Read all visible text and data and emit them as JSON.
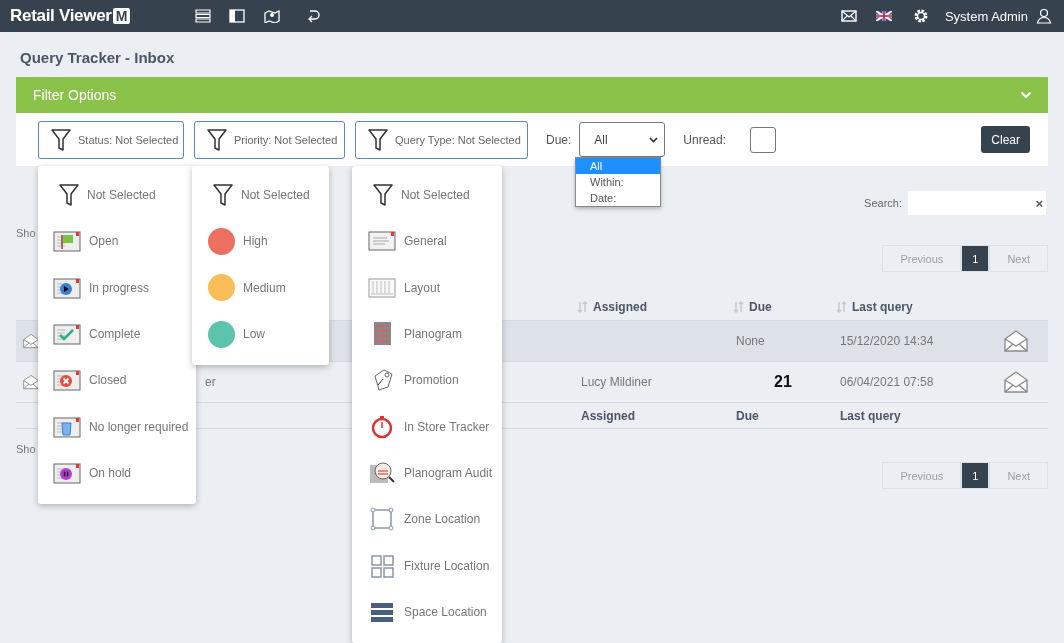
{
  "top_bar": {
    "logo": "Retail Viewer",
    "logo_badge": "M",
    "user": "System Admin"
  },
  "page_title": "Query Tracker - Inbox",
  "filter_panel": {
    "title": "Filter Options",
    "filters": [
      {
        "label": "Status: Not Selected"
      },
      {
        "label": "Priority: Not Selected"
      },
      {
        "label": "Query Type: Not Selected"
      }
    ],
    "due": {
      "label": "Due:",
      "value": "All",
      "options": [
        {
          "label": "All",
          "selected": true
        },
        {
          "label": "Within:",
          "selected": false
        },
        {
          "label": "Date:",
          "selected": false
        }
      ]
    },
    "unread": {
      "label": "Unread:",
      "checked": false
    },
    "clear": "Clear"
  },
  "status_menu": [
    {
      "label": "Not Selected",
      "kind": "none"
    },
    {
      "label": "Open",
      "kind": "icon"
    },
    {
      "label": "In progress",
      "kind": "icon"
    },
    {
      "label": "Complete",
      "kind": "icon"
    },
    {
      "label": "Closed",
      "kind": "icon"
    },
    {
      "label": "No longer required",
      "kind": "icon"
    },
    {
      "label": "On hold",
      "kind": "icon"
    }
  ],
  "priority_menu": [
    {
      "label": "Not Selected",
      "kind": "none"
    },
    {
      "label": "High",
      "kind": "dot",
      "color": "#ec6f5f"
    },
    {
      "label": "Medium",
      "kind": "dot",
      "color": "#f9be55"
    },
    {
      "label": "Low",
      "kind": "dot",
      "color": "#5cc3ad"
    }
  ],
  "query_type_menu": [
    {
      "label": "Not Selected",
      "kind": "none"
    },
    {
      "label": "General",
      "kind": "icon"
    },
    {
      "label": "Layout",
      "kind": "icon"
    },
    {
      "label": "Planogram",
      "kind": "icon"
    },
    {
      "label": "Promotion",
      "kind": "icon"
    },
    {
      "label": "In Store Tracker",
      "kind": "icon"
    },
    {
      "label": "Planogram Audit",
      "kind": "icon"
    },
    {
      "label": "Zone Location",
      "kind": "icon"
    },
    {
      "label": "Fixture Location",
      "kind": "icon"
    },
    {
      "label": "Space Location",
      "kind": "icon"
    }
  ],
  "search": {
    "label": "Search:",
    "clear": "×"
  },
  "length_text": "Sho",
  "info_text": "Sho",
  "pagination_top": [
    {
      "label": "Previous",
      "disabled": true,
      "selected": false
    },
    {
      "label": "1",
      "disabled": false,
      "selected": true
    },
    {
      "label": "Next",
      "disabled": true,
      "selected": false
    }
  ],
  "pagination_bottom": [
    {
      "label": "Previous",
      "disabled": true,
      "selected": false
    },
    {
      "label": "1",
      "disabled": false,
      "selected": true
    },
    {
      "label": "Next",
      "disabled": true,
      "selected": false
    }
  ],
  "table": {
    "columns": [
      {
        "label": "Assigned"
      },
      {
        "label": "Due"
      },
      {
        "label": "Last query"
      }
    ],
    "rows": [
      {
        "due": {
          "kind": "text",
          "text": "None"
        },
        "last_query": "15/12/2020 14:34",
        "highlighted": true
      },
      {
        "column_1": "er",
        "assigned": "Lucy Mildiner",
        "due": {
          "kind": "days",
          "text": "21"
        },
        "last_query": "06/04/2021 07:58",
        "highlighted": false
      }
    ],
    "footer": {
      "columns": [
        {
          "label": "Assigned"
        },
        {
          "label": "Due"
        },
        {
          "label": "Last query"
        }
      ]
    }
  }
}
